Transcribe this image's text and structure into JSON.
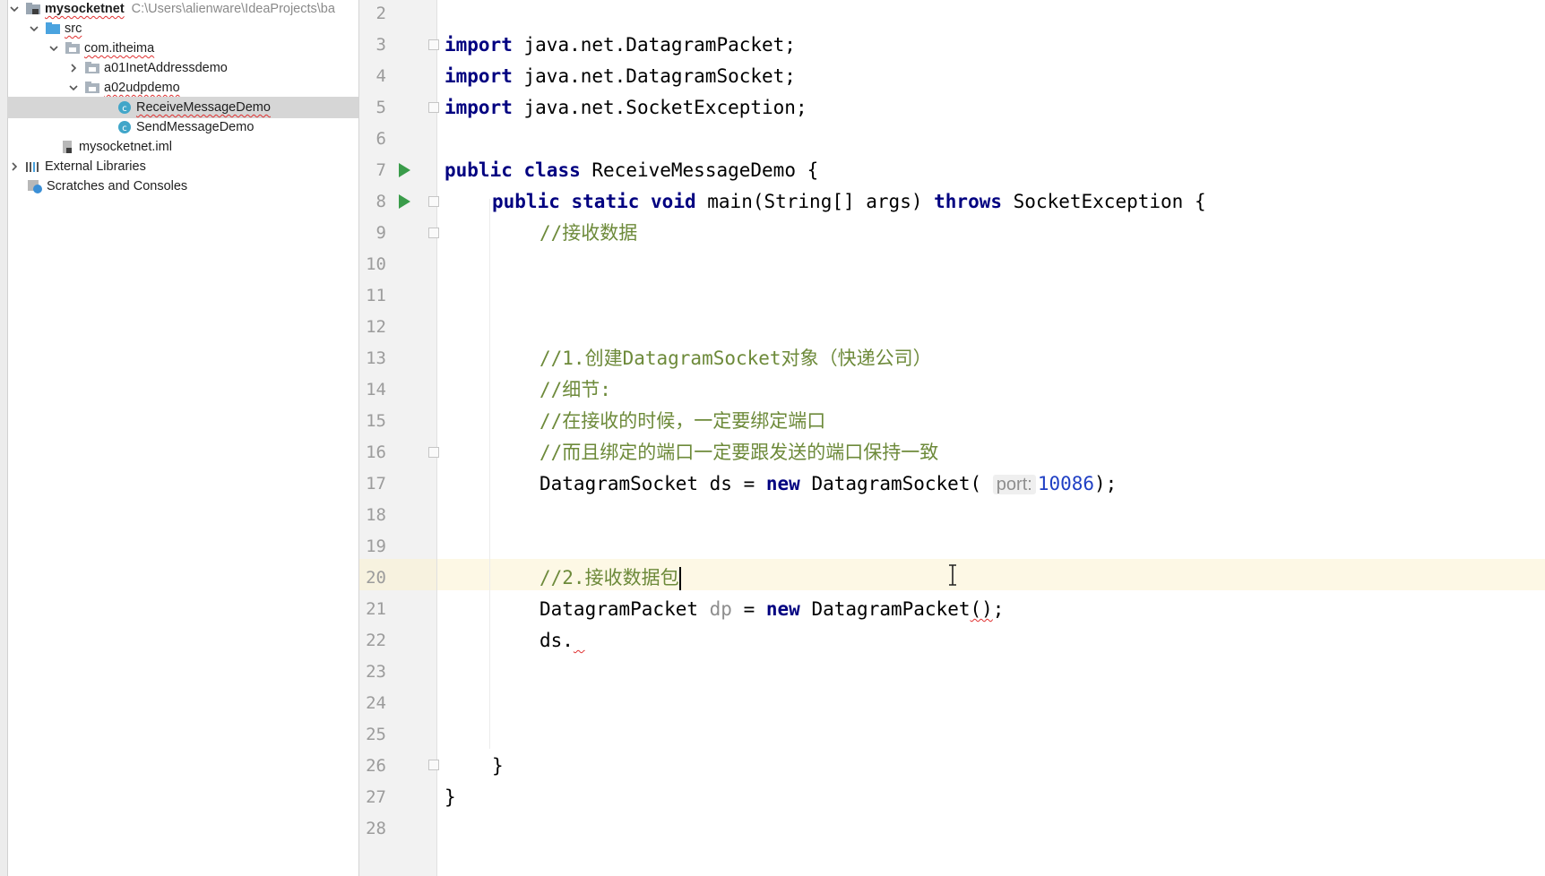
{
  "project": {
    "root_name": "mysocketnet",
    "root_path": "C:\\Users\\alienware\\IdeaProjects\\ba",
    "src": "src",
    "package": "com.itheima",
    "folder1": "a01InetAddressdemo",
    "folder2": "a02udpdemo",
    "file_selected": "ReceiveMessageDemo",
    "file2": "SendMessageDemo",
    "iml": "mysocketnet.iml",
    "ext_libs": "External Libraries",
    "scratches": "Scratches and Consoles"
  },
  "code": {
    "line_numbers": [
      "2",
      "3",
      "4",
      "5",
      "6",
      "7",
      "8",
      "9",
      "10",
      "11",
      "12",
      "13",
      "14",
      "15",
      "16",
      "17",
      "18",
      "19",
      "20",
      "21",
      "22",
      "23",
      "24",
      "25",
      "26",
      "27",
      "28"
    ],
    "kw_import": "import",
    "l3": "java.net.DatagramPacket;",
    "l4": "java.net.DatagramSocket;",
    "l5": "java.net.SocketException;",
    "kw_public": "public",
    "kw_class": "class",
    "l7_rest": "ReceiveMessageDemo {",
    "kw_static": "static",
    "kw_void": "void",
    "l8_main": "main(String[] args)",
    "kw_throws": "throws",
    "l8_rest": "SocketException {",
    "l9": "//接收数据",
    "l13": "//1.创建DatagramSocket对象（快递公司）",
    "l14": "//细节:",
    "l15": "//在接收的时候，一定要绑定端口",
    "l16": "//而且绑定的端口一定要跟发送的端口保持一致",
    "l17_a": "DatagramSocket ds = ",
    "kw_new": "new",
    "l17_b": "DatagramSocket(",
    "l17_hint": "port:",
    "l17_num": "10086",
    "l17_end": ");",
    "l20": "//2.接收数据包",
    "l21_a": "DatagramPacket ",
    "l21_dp": "dp",
    "l21_b": " = ",
    "l21_c": "DatagramPacket",
    "l21_paren": "()",
    "l21_end": ";",
    "l22": "ds.",
    "l26": "}",
    "l27": "}"
  }
}
